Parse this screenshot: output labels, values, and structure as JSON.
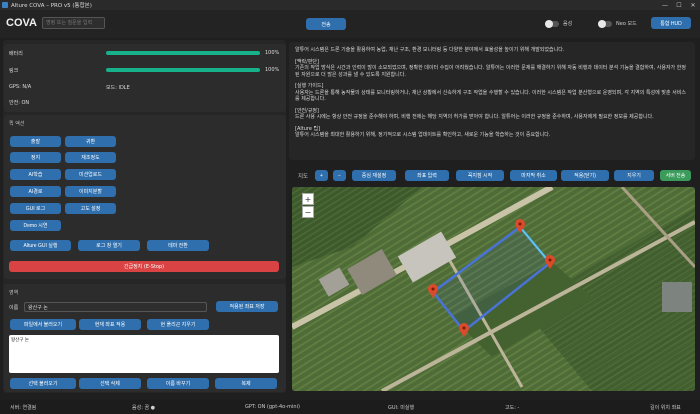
{
  "window": {
    "title": "Alture COVA – PRO v5 (통합본)",
    "controls": [
      "—",
      "☐",
      "✕"
    ]
  },
  "header": {
    "brand": "COVA",
    "search_placeholder": "명령 또는 질문을 입력",
    "send_label": "전송",
    "voice_label": "음성",
    "neo_label": "Neo 모드",
    "hud_label": "통합 HUD",
    "voice_on": false,
    "neo_on": false
  },
  "status": {
    "battery_label": "배터리",
    "battery_pct": 100,
    "battery_text": "100%",
    "link_label": "링크",
    "link_pct": 100,
    "link_text": "100%",
    "gps": "GPS: N/A",
    "mode": "모드: IDLE",
    "safety": "안전: ON"
  },
  "quick_actions": {
    "title": "퀵 액션",
    "buttons": [
      "출발",
      "귀환",
      "정지",
      "재조정도",
      "AI학습",
      "미션업로드",
      "AI경로",
      "이미지분할",
      "GUI 로그",
      "고도 설정",
      "Demo 시연"
    ],
    "wide_buttons": [
      "Alture GUI 실행",
      "로그 창 열기",
      "테마 전환"
    ],
    "estop": "긴급정지 (E-Stop)"
  },
  "area": {
    "title": "영역",
    "name_label": "이름",
    "name_value": "왕산구 논",
    "save_btn": "적용된 좌표 저장",
    "row1": [
      "파일에서 불러오기",
      "현재 좌표 적용",
      "현 폴리곤 지우기"
    ],
    "list_items": [
      "왕산구 논"
    ],
    "row2": [
      "선택 불러오기",
      "선택 삭제",
      "이름 바꾸기",
      "복제"
    ]
  },
  "info": {
    "paragraphs": [
      "알튜어 시스템은 드론 기술을 활용하여 농업, 재난 구조, 환경 모니터링 등 다양한 분야에서 효율성을 높이기 위해 개발되었습니다.",
      "",
      "[맥락/판단]",
      "기존의 작업 방식은 시간과 인력이 많이 소모되었으며, 정확한 데이터 수집이 어려웠습니다. 알튜어는 이러한 문제를 해결하기 위해 자동 비행과 데이터 분석 기능을 결합하여, 사용자가 한정된 자원으로 더 많은 성과를 낼 수 있도록 지원합니다.",
      "",
      "[실행 가이드]",
      "사용자는 드론을 통해 농작물의 상태를 모니터링하거나, 재난 상황에서 신속하게 구조 작업을 수행할 수 있습니다. 이러한 시스템은 작업 분산형으로 운영되며, 각 지역의 특성에 맞춘 서비스를 제공합니다.",
      "",
      "[안전/규정]",
      "드론 사용 시에는 항상 안전 규정을 준수해야 하며, 비행 전에는 해당 지역의 허가를 받아야 합니다. 알튜어는 이러한 규정을 준수하며, 사용자에게 필요한 정보를 제공합니다.",
      "",
      "[Alture 팁]",
      "알튜어 시스템을 최대한 활용하기 위해, 정기적으로 시스템 업데이트를 확인하고, 새로운 기능을 학습하는 것이 중요합니다."
    ]
  },
  "map": {
    "label": "지도",
    "zoom_in": "+",
    "zoom_out": "−",
    "buttons": [
      "중심 재설정",
      "좌표 입력",
      "꼭지점 시작",
      "마지막 취소",
      "적용(닫기)",
      "지우기",
      "서버 전송"
    ],
    "map_zoom_in": "+",
    "map_zoom_out": "−"
  },
  "statusbar": {
    "server": "서버: 연결됨",
    "voice": "음성: 끔 ●",
    "gpt": "GPT: ON (gpt-4o-mini)",
    "gui": "GUI: 미실행",
    "altitude": "고도: -",
    "coords": "길이 위치 좌표"
  }
}
